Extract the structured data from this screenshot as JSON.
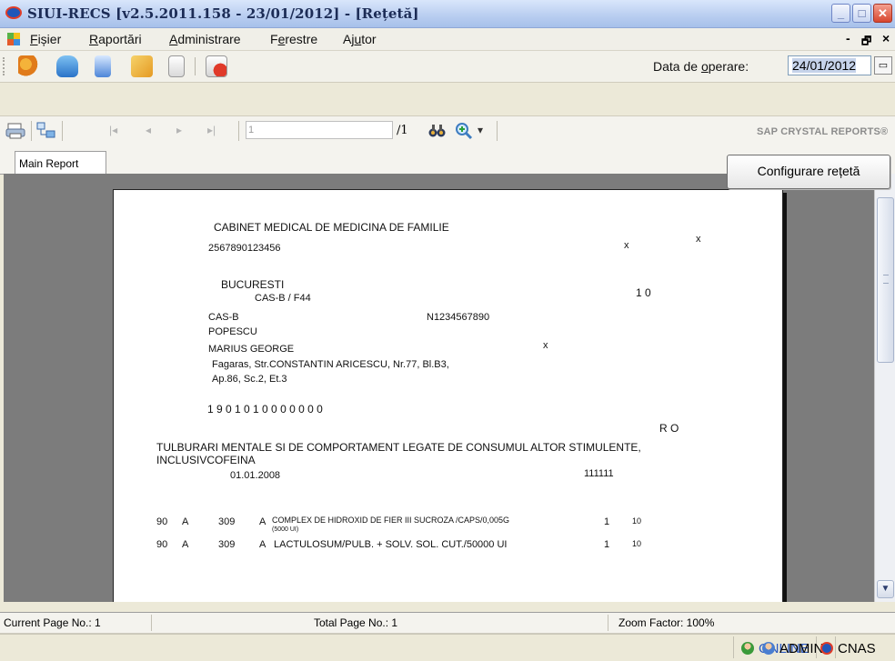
{
  "window": {
    "title": "SIUI-RECS [v2.5.2011.158 - 23/01/2012] - [Rețetă]",
    "minimize": "_",
    "maximize": "□",
    "close": "✕"
  },
  "menu": {
    "items": [
      {
        "label": "Fișier"
      },
      {
        "label": "Raportări"
      },
      {
        "label": "Administrare"
      },
      {
        "label": "Ferestre"
      },
      {
        "label": "Ajutor"
      }
    ],
    "mdi_minimize": "-",
    "mdi_restore": "🗗",
    "mdi_close": "×"
  },
  "toolbar": {
    "buttons": [
      "users-icon",
      "database-icon",
      "prescription-icon",
      "notes-icon",
      "document-icon",
      "delete-document-icon"
    ],
    "data_label": "Data de operare:",
    "data_value": "24/01/2012",
    "calendar_glyph": "▭"
  },
  "report_toolbar": {
    "print_icon": "printer-icon",
    "tree_icon": "group-tree-icon",
    "first": "|◂",
    "prev": "◂",
    "next": "▸",
    "last": "▸|",
    "page_value": "1",
    "page_total": "/1",
    "find_icon": "binoculars-icon",
    "zoom_icon": "zoom-icon",
    "zoom_dropdown": "▾",
    "brand": "SAP CRYSTAL REPORTS®"
  },
  "tabs": [
    {
      "label": "Main Report"
    }
  ],
  "configure_button": "Configurare rețetă",
  "report": {
    "cabinet": "CABINET MEDICAL DE MEDICINA DE FAMILIE",
    "cod": "2567890123456",
    "x1": "x",
    "x2": "x",
    "oras": "BUCURESTI",
    "cas_contract": "CAS-B / F44",
    "nr_1_0": "1  0",
    "cas": "CAS-B",
    "medic_cod": "N1234567890",
    "nume": "POPESCU",
    "prenume": "MARIUS GEORGE",
    "x3": "x",
    "adresa1": "Fagaras, Str.CONSTANTIN ARICESCU, Nr.77, Bl.B3,",
    "adresa2": "Ap.86, Sc.2, Et.3",
    "cnp": "1  9  0  1  0  1  0  0  0  0  0  0  0",
    "ro": "R  O",
    "diagnostic1": "TULBURARI MENTALE SI DE COMPORTAMENT LEGATE DE CONSUMUL ALTOR STIMULENTE,",
    "diagnostic2": "INCLUSIVCOFEINA",
    "data": "01.01.2008",
    "cod_diag": "111111",
    "items": [
      {
        "c1": "90",
        "c2": "A",
        "c3": "309",
        "c4": "A",
        "name": "COMPLEX DE HIDROXID DE FIER III SUCROZA /CAPS/0,005G",
        "sub": "(5000 UI)",
        "q": "1",
        "d": "10"
      },
      {
        "c1": "90",
        "c2": "A",
        "c3": "309",
        "c4": "A",
        "name": "LACTULOSUM/PULB. + SOLV. SOL. CUT./50000 UI",
        "sub": "",
        "q": "1",
        "d": "10"
      }
    ]
  },
  "status": {
    "current_page": "Current Page No.: 1",
    "total_page": "Total Page No.: 1",
    "zoom": "Zoom Factor: 100%"
  },
  "app_status": {
    "online": "ONLINE",
    "user": "ADMIN",
    "server": "CNAS"
  },
  "colors": {
    "title_bar": "#b8cdf0",
    "close_button": "#d8462e",
    "viewer_background": "#7c7c7c",
    "online_status": "#2a58c0"
  }
}
